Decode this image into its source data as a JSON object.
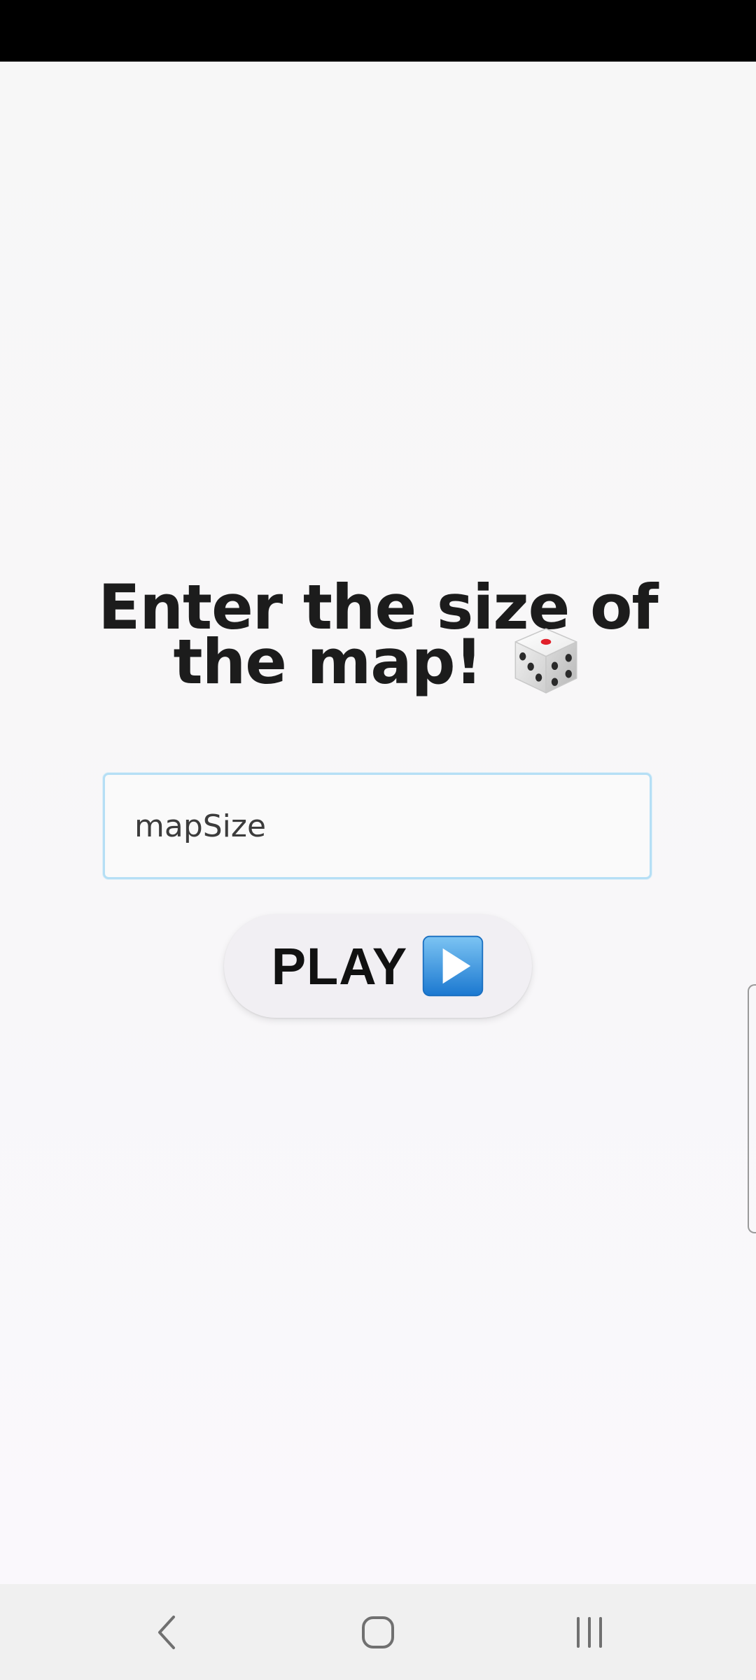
{
  "screen": {
    "title": "Enter the size of the map!",
    "title_emoji_icon": "dice-icon"
  },
  "map_size_input": {
    "value": "",
    "placeholder": "mapSize"
  },
  "play_button": {
    "label": "PLAY",
    "icon": "play-icon"
  },
  "navigation_bar": {
    "back_icon": "back-icon",
    "home_icon": "home-icon",
    "recents_icon": "recents-icon"
  },
  "colors": {
    "input_border": "#b5dff5",
    "play_icon_blue": "#2f8ee0",
    "dice_pip_red": "#e0202a"
  }
}
